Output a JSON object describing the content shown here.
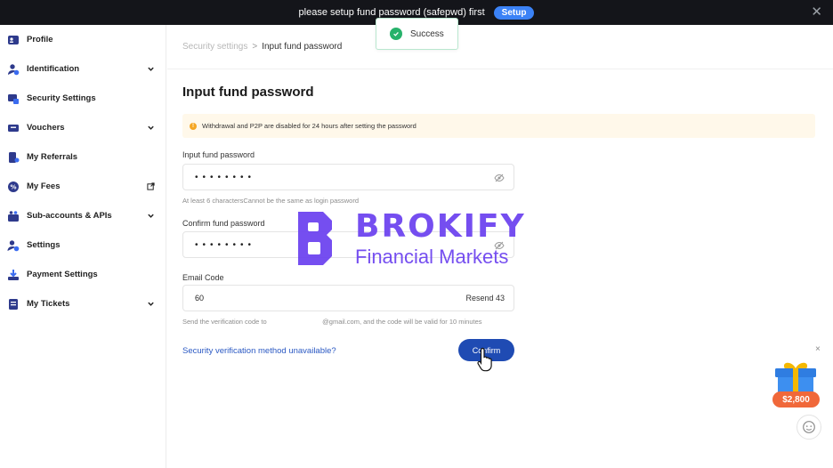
{
  "banner": {
    "message": "please setup fund password (safepwd) first",
    "setup_label": "Setup",
    "close_glyph": "✕"
  },
  "toast": {
    "text": "Success",
    "icon": "check-circle-icon"
  },
  "sidebar": {
    "items": [
      {
        "label": "Profile",
        "icon": "profile-card-icon",
        "trail": ""
      },
      {
        "label": "Identification",
        "icon": "user-check-icon",
        "trail": "chevron-down"
      },
      {
        "label": "Security Settings",
        "icon": "shield-lock-icon",
        "trail": ""
      },
      {
        "label": "Vouchers",
        "icon": "voucher-icon",
        "trail": "chevron-down"
      },
      {
        "label": "My Referrals",
        "icon": "referral-icon",
        "trail": ""
      },
      {
        "label": "My Fees",
        "icon": "percent-icon",
        "trail": "external-link"
      },
      {
        "label": "Sub-accounts & APIs",
        "icon": "sub-accounts-icon",
        "trail": "chevron-down"
      },
      {
        "label": "Settings",
        "icon": "user-gear-icon",
        "trail": ""
      },
      {
        "label": "Payment Settings",
        "icon": "payment-download-icon",
        "trail": ""
      },
      {
        "label": "My Tickets",
        "icon": "ticket-icon",
        "trail": "chevron-down"
      }
    ]
  },
  "breadcrumb": {
    "parent": "Security settings",
    "separator": ">",
    "current": "Input fund password"
  },
  "form": {
    "title": "Input fund password",
    "warning": "Withdrawal and P2P are disabled for 24 hours after setting the password",
    "password": {
      "label": "Input fund password",
      "value": "••••••••",
      "hint": "At least 6 charactersCannot be the same as login password"
    },
    "confirm_password": {
      "label": "Confirm fund password",
      "value": "••••••••"
    },
    "email_code": {
      "label": "Email Code",
      "value": "60",
      "resend": "Resend 43",
      "hint": "Send the verification code to                              @gmail.com, and the code will be valid for 10 minutes"
    },
    "unavailable_link": "Security verification method unavailable?",
    "confirm_label": "Confirm"
  },
  "watermark": {
    "brand": "BROKIFY",
    "tagline": "Financial Markets"
  },
  "promo": {
    "amount": "$2,800",
    "close_glyph": "×"
  },
  "colors": {
    "accent": "#1f4bb3",
    "link": "#2b59c3",
    "success": "#27b26b",
    "warning": "#f5a623",
    "brand": "#663bee",
    "promo": "#f0683a"
  }
}
